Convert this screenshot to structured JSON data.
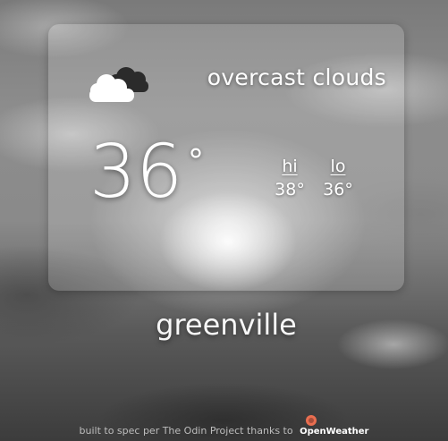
{
  "weather": {
    "icon": "cloud-icon",
    "description": "overcast clouds",
    "temperature": "36",
    "degree_symbol": "°",
    "hi_label": "hi",
    "hi_value": "38°",
    "lo_label": "lo",
    "lo_value": "36°"
  },
  "location": {
    "city": "greenville"
  },
  "footer": {
    "credit_text": "built to spec per The Odin Project thanks to",
    "provider_label": "OpenWeather",
    "provider_logo_icon": "openweather-logo-icon"
  }
}
